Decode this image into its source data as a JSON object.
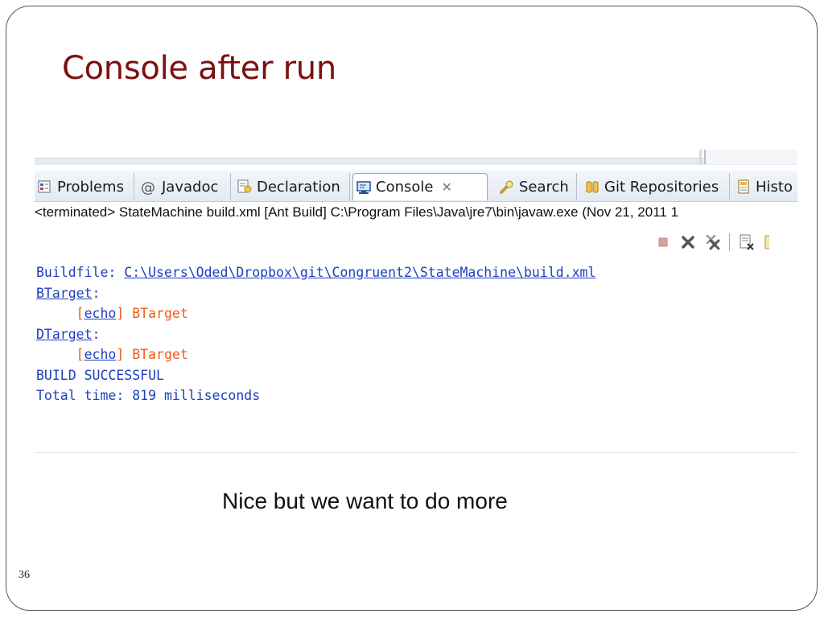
{
  "slide": {
    "title": "Console after run",
    "caption": "Nice but we want to do more",
    "page_number": "36"
  },
  "tabs": [
    {
      "label": "Problems",
      "icon": "problems-icon"
    },
    {
      "label": "Javadoc",
      "icon": "at-icon"
    },
    {
      "label": "Declaration",
      "icon": "declaration-icon"
    },
    {
      "label": "Console",
      "icon": "console-icon",
      "active": true
    },
    {
      "label": "Search",
      "icon": "search-flashlight-icon"
    },
    {
      "label": "Git Repositories",
      "icon": "git-repositories-icon"
    },
    {
      "label": "Histo",
      "icon": "history-icon"
    }
  ],
  "console_status": "<terminated> StateMachine build.xml [Ant Build] C:\\Program Files\\Java\\jre7\\bin\\javaw.exe (Nov 21, 2011 1",
  "toolbar_icons": [
    "terminate-icon",
    "remove-launch-icon",
    "remove-all-terminated-icon",
    "clear-console-icon",
    "scroll-lock-icon"
  ],
  "console_output": {
    "buildfile_label": "Buildfile: ",
    "buildfile_path": "C:\\Users\\Oded\\Dropbox\\git\\Congruent2\\StateMachine\\build.xml",
    "target1": "BTarget",
    "colon": ":",
    "indent": "     ",
    "bracket_open": "[",
    "task": "echo",
    "bracket_close": "]",
    "echo1": " BTarget",
    "target2": "DTarget",
    "echo2": " BTarget",
    "result": "BUILD SUCCESSFUL",
    "total_time": "Total time: 819 milliseconds"
  },
  "colors": {
    "title": "#7b1111",
    "console_text": "#1d3fbf",
    "echo_text": "#f05a1a"
  }
}
